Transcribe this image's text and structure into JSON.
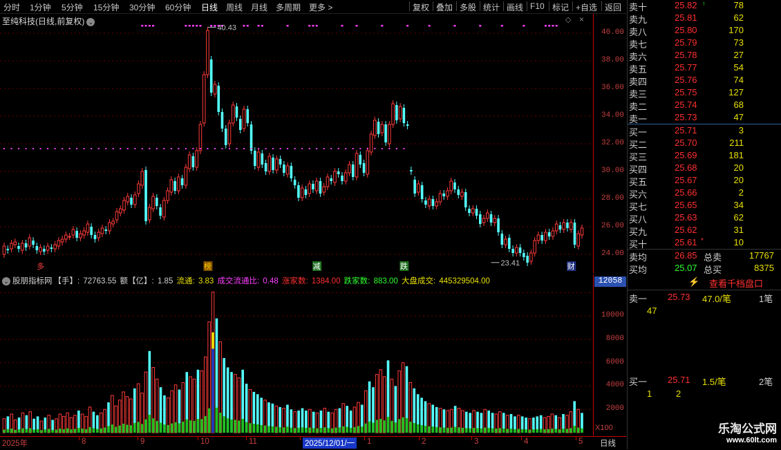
{
  "toolbar": {
    "periods": [
      "分时",
      "1分钟",
      "5分钟",
      "15分钟",
      "30分钟",
      "60分钟",
      "日线",
      "周线",
      "月线",
      "多周期",
      "更多 >"
    ],
    "active_period": "日线",
    "actions": [
      "复权",
      "叠加",
      "多股",
      "统计",
      "画线",
      "F10",
      "标记",
      "+自选",
      "返回"
    ]
  },
  "stock": {
    "title": "至纯科技(日线,前复权)"
  },
  "price_axis": [
    "40.00",
    "38.00",
    "36.00",
    "34.00",
    "32.00",
    "30.00",
    "28.00",
    "26.00",
    "24.00"
  ],
  "annotations": {
    "high": "40.43",
    "low": "23.41"
  },
  "markers": [
    {
      "text": "多",
      "color": "#ff4040",
      "bg": "none"
    },
    {
      "text": "榜",
      "color": "#ffd000",
      "bg": "#805000"
    },
    {
      "text": "减",
      "color": "#ffffff",
      "bg": "#207020"
    },
    {
      "text": "跌",
      "color": "#ffffff",
      "bg": "#207020"
    },
    {
      "text": "财",
      "color": "#ffffff",
      "bg": "#203080"
    }
  ],
  "volume_header": {
    "name": "股朋指标网",
    "items": [
      {
        "label": "【手】: ",
        "value": "72763.55",
        "color": "#d0d0d0"
      },
      {
        "label": " 额【亿】: ",
        "value": "1.85",
        "color": "#d0d0d0"
      },
      {
        "label": " 流通: ",
        "value": "3.83",
        "color": "#e8e000"
      },
      {
        "label": " 成交流通比: ",
        "value": "0.48",
        "color": "#ff40ff"
      },
      {
        "label": " 涨家数: ",
        "value": "1384.00",
        "color": "#ff3030"
      },
      {
        "label": " 跌家数: ",
        "value": "883.00",
        "color": "#30ff30"
      },
      {
        "label": " 大盘成交: ",
        "value": "445329504.00",
        "color": "#e8e000"
      }
    ]
  },
  "volume_axis": {
    "current": "12058",
    "ticks": [
      "12000",
      "10000",
      "8000",
      "6000",
      "4000",
      "2000"
    ],
    "unit": "X100"
  },
  "date_axis": {
    "labels": [
      "2025年",
      "8",
      "9",
      "10",
      "11",
      "2025/12/01/一",
      "1",
      "2",
      "3",
      "4",
      "5"
    ],
    "period": "日线"
  },
  "order_book": {
    "sells": [
      {
        "label": "卖十",
        "price": "25.82",
        "vol": "78"
      },
      {
        "label": "卖九",
        "price": "25.81",
        "vol": "62"
      },
      {
        "label": "卖八",
        "price": "25.80",
        "vol": "170"
      },
      {
        "label": "卖七",
        "price": "25.79",
        "vol": "73"
      },
      {
        "label": "卖六",
        "price": "25.78",
        "vol": "27"
      },
      {
        "label": "卖五",
        "price": "25.77",
        "vol": "54"
      },
      {
        "label": "卖四",
        "price": "25.76",
        "vol": "74"
      },
      {
        "label": "卖三",
        "price": "25.75",
        "vol": "127"
      },
      {
        "label": "卖二",
        "price": "25.74",
        "vol": "68"
      },
      {
        "label": "卖一",
        "price": "25.73",
        "vol": "47"
      }
    ],
    "buys": [
      {
        "label": "买一",
        "price": "25.71",
        "vol": "3"
      },
      {
        "label": "买二",
        "price": "25.70",
        "vol": "211"
      },
      {
        "label": "买三",
        "price": "25.69",
        "vol": "181"
      },
      {
        "label": "买四",
        "price": "25.68",
        "vol": "20"
      },
      {
        "label": "买五",
        "price": "25.67",
        "vol": "20"
      },
      {
        "label": "买六",
        "price": "25.66",
        "vol": "2"
      },
      {
        "label": "买七",
        "price": "25.65",
        "vol": "34"
      },
      {
        "label": "买八",
        "price": "25.63",
        "vol": "62"
      },
      {
        "label": "买九",
        "price": "25.62",
        "vol": "31"
      },
      {
        "label": "买十",
        "price": "25.61",
        "vol": "10"
      }
    ],
    "summary": [
      {
        "label": "卖均",
        "price": "26.85",
        "label2": "总卖",
        "vol": "17767",
        "price_color": "#ff3030"
      },
      {
        "label": "买均",
        "price": "25.07",
        "label2": "总买",
        "vol": "8375",
        "price_color": "#30ff30"
      }
    ],
    "qian_dang_button": "查看千档盘口",
    "queue": [
      {
        "label": "卖一",
        "price": "25.73",
        "amount": "47.0/笔",
        "count": "1笔",
        "orders": [
          "47"
        ]
      },
      {
        "label": "买一",
        "price": "25.71",
        "amount": "1.5/笔",
        "count": "2笔",
        "orders": [
          "1",
          "2"
        ]
      }
    ]
  },
  "watermark": {
    "title": "乐淘公式网",
    "url": "www.60lt.com"
  },
  "chart_data": {
    "type": "candlestick",
    "price_range": [
      23.0,
      41.0
    ],
    "candles": [
      [
        24.0,
        24.6
      ],
      [
        24.4,
        24.3
      ],
      [
        24.4,
        24.8
      ],
      [
        24.7,
        24.9
      ],
      [
        24.6,
        24.4
      ],
      [
        24.3,
        24.8
      ],
      [
        24.8,
        24.5
      ],
      [
        24.6,
        25.2
      ],
      [
        25.0,
        24.7
      ],
      [
        24.6,
        24.3
      ],
      [
        24.2,
        24.5
      ],
      [
        24.4,
        24.2
      ],
      [
        24.3,
        24.6
      ],
      [
        24.5,
        24.4
      ],
      [
        24.4,
        24.7
      ],
      [
        24.6,
        25.0
      ],
      [
        24.9,
        25.1
      ],
      [
        25.1,
        25.4
      ],
      [
        25.3,
        25.3
      ],
      [
        25.4,
        25.8
      ],
      [
        25.7,
        25.2
      ],
      [
        25.2,
        25.5
      ],
      [
        25.4,
        25.7
      ],
      [
        25.6,
        26.2
      ],
      [
        26.0,
        25.4
      ],
      [
        25.4,
        25.1
      ],
      [
        25.2,
        25.6
      ],
      [
        25.5,
        25.9
      ],
      [
        25.8,
        25.7
      ],
      [
        25.7,
        26.3
      ],
      [
        26.2,
        26.4
      ],
      [
        26.5,
        27.1
      ],
      [
        27.0,
        27.3
      ],
      [
        27.2,
        27.9
      ],
      [
        27.8,
        28.2
      ],
      [
        28.1,
        27.6
      ],
      [
        27.6,
        28.3
      ],
      [
        28.4,
        29.1
      ],
      [
        29.0,
        30.0
      ],
      [
        30.1,
        26.4
      ],
      [
        26.5,
        27.4
      ],
      [
        27.3,
        28.2
      ],
      [
        28.1,
        27.5
      ],
      [
        27.4,
        26.8
      ],
      [
        26.7,
        27.9
      ],
      [
        27.9,
        28.6
      ],
      [
        28.5,
        29.4
      ],
      [
        29.3,
        28.6
      ],
      [
        28.6,
        29.6
      ],
      [
        29.5,
        29.0
      ],
      [
        29.0,
        30.3
      ],
      [
        30.2,
        31.2
      ],
      [
        31.1,
        30.3
      ],
      [
        30.3,
        31.5
      ],
      [
        31.5,
        33.4
      ],
      [
        33.5,
        37.0
      ],
      [
        37.0,
        40.2
      ],
      [
        38.1,
        35.7
      ],
      [
        35.6,
        36.3
      ],
      [
        36.2,
        34.3
      ],
      [
        34.3,
        33.1
      ],
      [
        33.1,
        31.9
      ],
      [
        32.0,
        33.5
      ],
      [
        33.5,
        34.8
      ],
      [
        34.7,
        33.9
      ],
      [
        33.8,
        33.0
      ],
      [
        33.1,
        34.5
      ],
      [
        34.5,
        33.5
      ],
      [
        33.4,
        31.5
      ],
      [
        31.5,
        30.4
      ],
      [
        30.3,
        31.4
      ],
      [
        31.3,
        30.5
      ],
      [
        30.6,
        30.0
      ],
      [
        30.0,
        31.1
      ],
      [
        31.0,
        30.1
      ],
      [
        30.1,
        30.9
      ],
      [
        30.9,
        30.5
      ],
      [
        30.5,
        29.9
      ],
      [
        29.8,
        30.4
      ],
      [
        30.4,
        29.5
      ],
      [
        29.4,
        29.0
      ],
      [
        29.0,
        28.1
      ],
      [
        28.1,
        28.8
      ],
      [
        28.7,
        28.3
      ],
      [
        28.4,
        29.1
      ],
      [
        29.1,
        28.7
      ],
      [
        28.6,
        29.3
      ],
      [
        29.3,
        28.4
      ],
      [
        28.5,
        28.9
      ],
      [
        28.9,
        29.6
      ],
      [
        29.5,
        29.3
      ],
      [
        29.2,
        30.0
      ],
      [
        30.0,
        29.8
      ],
      [
        29.7,
        29.3
      ],
      [
        29.3,
        29.9
      ],
      [
        29.9,
        30.5
      ],
      [
        30.5,
        29.6
      ],
      [
        29.6,
        31.3
      ],
      [
        31.2,
        30.5
      ],
      [
        30.6,
        29.9
      ],
      [
        29.8,
        31.5
      ],
      [
        31.4,
        32.7
      ],
      [
        32.6,
        33.7
      ],
      [
        33.6,
        32.7
      ],
      [
        32.8,
        33.4
      ],
      [
        33.4,
        32.1
      ],
      [
        32.0,
        33.4
      ],
      [
        33.4,
        34.9
      ],
      [
        34.8,
        33.7
      ],
      [
        33.8,
        34.7
      ],
      [
        34.6,
        33.5
      ],
      [
        33.4,
        33.3
      ],
      [
        30.1,
        30.0
      ],
      [
        29.4,
        28.4
      ],
      [
        28.5,
        29.1
      ],
      [
        29.0,
        28.0
      ],
      [
        27.9,
        27.6
      ],
      [
        27.5,
        28.0
      ],
      [
        28.0,
        27.5
      ],
      [
        27.5,
        27.8
      ],
      [
        27.8,
        28.4
      ],
      [
        28.4,
        28.2
      ],
      [
        28.2,
        28.6
      ],
      [
        28.6,
        29.3
      ],
      [
        29.2,
        28.7
      ],
      [
        28.7,
        28.3
      ],
      [
        28.2,
        28.5
      ],
      [
        28.5,
        27.4
      ],
      [
        27.3,
        27.0
      ],
      [
        27.0,
        27.3
      ],
      [
        27.3,
        26.8
      ],
      [
        26.9,
        26.2
      ],
      [
        26.3,
        26.6
      ],
      [
        26.6,
        27.0
      ],
      [
        26.9,
        26.3
      ],
      [
        26.3,
        26.6
      ],
      [
        26.6,
        25.6
      ],
      [
        25.5,
        24.7
      ],
      [
        24.7,
        25.1
      ],
      [
        25.2,
        24.4
      ],
      [
        24.4,
        24.1
      ],
      [
        24.1,
        24.5
      ],
      [
        24.5,
        24.1
      ],
      [
        24.1,
        23.8
      ],
      [
        23.9,
        23.4
      ],
      [
        23.5,
        24.1
      ],
      [
        24.1,
        25.0
      ],
      [
        25.0,
        25.4
      ],
      [
        25.4,
        25.0
      ],
      [
        25.0,
        25.6
      ],
      [
        25.6,
        25.3
      ],
      [
        25.3,
        25.7
      ],
      [
        25.7,
        26.2
      ],
      [
        26.1,
        25.8
      ],
      [
        25.8,
        26.3
      ],
      [
        26.3,
        25.9
      ],
      [
        25.8,
        26.3
      ],
      [
        26.3,
        24.7
      ],
      [
        24.6,
        25.5
      ],
      [
        25.4,
        25.9
      ]
    ],
    "volume_range": [
      0,
      12500
    ],
    "volumes": [
      1200,
      1400,
      1600,
      1100,
      1300,
      1700,
      1500,
      1800,
      1200,
      1400,
      1000,
      1300,
      1500,
      1100,
      1200,
      1600,
      1400,
      1700,
      1300,
      1500,
      1900,
      1600,
      1400,
      2200,
      1800,
      1500,
      1700,
      2000,
      2600,
      3200,
      2300,
      2800,
      3500,
      3100,
      2900,
      3800,
      4200,
      3400,
      5200,
      7000,
      5600,
      4600,
      3900,
      3200,
      3000,
      3600,
      4100,
      3700,
      4300,
      5200,
      4800,
      4600,
      5400,
      5300,
      6500,
      9500,
      12058,
      9800,
      7800,
      6400,
      5600,
      5200,
      5000,
      4700,
      5400,
      4200,
      3700,
      3500,
      3300,
      3000,
      2800,
      2600,
      2500,
      2300,
      2200,
      2100,
      2400,
      2000,
      1800,
      1900,
      2100,
      1900,
      2000,
      1800,
      1700,
      1900,
      2100,
      1800,
      1700,
      2000,
      2100,
      2500,
      2300,
      1900,
      2200,
      2600,
      2400,
      3600,
      4400,
      3900,
      5000,
      5400,
      4800,
      6200,
      4600,
      4000,
      5300,
      6000,
      5700,
      4300,
      3800,
      3300,
      3000,
      2700,
      2500,
      2400,
      2200,
      2100,
      2000,
      1900,
      2000,
      2300,
      2100,
      1900,
      1800,
      1700,
      1900,
      1800,
      1700,
      2000,
      1900,
      1700,
      1600,
      1800,
      1700,
      1500,
      1600,
      1400,
      1500,
      1400,
      1300,
      1200,
      1300,
      1400,
      1500,
      1300,
      1400,
      1600,
      1500,
      1300,
      1600,
      1500,
      1800,
      2700,
      2000,
      1700
    ]
  }
}
